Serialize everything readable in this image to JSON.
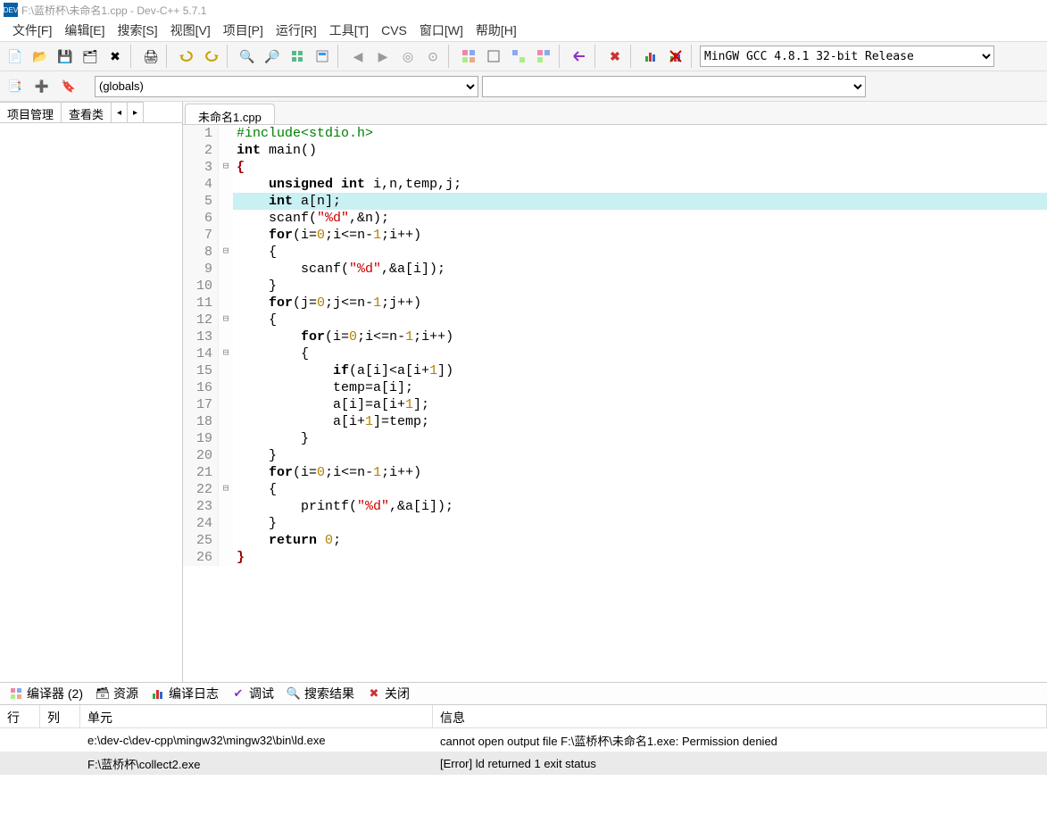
{
  "title": "F:\\蓝桥杯\\未命名1.cpp - Dev-C++ 5.7.1",
  "menu": [
    "文件[F]",
    "编辑[E]",
    "搜索[S]",
    "视图[V]",
    "项目[P]",
    "运行[R]",
    "工具[T]",
    "CVS",
    "窗口[W]",
    "帮助[H]"
  ],
  "compiler_combo": "MinGW GCC 4.8.1 32-bit Release",
  "globals_combo": "(globals)",
  "sidebar_tabs": {
    "project": "项目管理",
    "classview": "查看类"
  },
  "editor_tab": "未命名1.cpp",
  "code": [
    {
      "n": 1,
      "fold": "",
      "html": "<span class='pp'>#include&lt;stdio.h&gt;</span>"
    },
    {
      "n": 2,
      "fold": "",
      "html": "<span class='kw'>int</span> main()"
    },
    {
      "n": 3,
      "fold": "⊟",
      "html": "<span class='brace-red'>{</span>"
    },
    {
      "n": 4,
      "fold": "",
      "html": "    <span class='kw'>unsigned</span> <span class='kw'>int</span> i,n,temp,j;"
    },
    {
      "n": 5,
      "fold": "",
      "hl": true,
      "html": "    <span class='kw'>int</span> a[n];"
    },
    {
      "n": 6,
      "fold": "",
      "html": "    scanf(<span class='str'>\"%d\"</span>,&amp;n);"
    },
    {
      "n": 7,
      "fold": "",
      "html": "    <span class='kw'>for</span>(i=<span class='num'>0</span>;i&lt;=n-<span class='num'>1</span>;i++)"
    },
    {
      "n": 8,
      "fold": "⊟",
      "html": "    {"
    },
    {
      "n": 9,
      "fold": "",
      "html": "        scanf(<span class='str'>\"%d\"</span>,&amp;a[i]);"
    },
    {
      "n": 10,
      "fold": "",
      "html": "    }"
    },
    {
      "n": 11,
      "fold": "",
      "html": "    <span class='kw'>for</span>(j=<span class='num'>0</span>;j&lt;=n-<span class='num'>1</span>;j++)"
    },
    {
      "n": 12,
      "fold": "⊟",
      "html": "    {"
    },
    {
      "n": 13,
      "fold": "",
      "html": "        <span class='kw'>for</span>(i=<span class='num'>0</span>;i&lt;=n-<span class='num'>1</span>;i++)"
    },
    {
      "n": 14,
      "fold": "⊟",
      "html": "        {"
    },
    {
      "n": 15,
      "fold": "",
      "html": "            <span class='kw'>if</span>(a[i]&lt;a[i+<span class='num'>1</span>])"
    },
    {
      "n": 16,
      "fold": "",
      "html": "            temp=a[i];"
    },
    {
      "n": 17,
      "fold": "",
      "html": "            a[i]=a[i+<span class='num'>1</span>];"
    },
    {
      "n": 18,
      "fold": "",
      "html": "            a[i+<span class='num'>1</span>]=temp;"
    },
    {
      "n": 19,
      "fold": "",
      "html": "        }"
    },
    {
      "n": 20,
      "fold": "",
      "html": "    }"
    },
    {
      "n": 21,
      "fold": "",
      "html": "    <span class='kw'>for</span>(i=<span class='num'>0</span>;i&lt;=n-<span class='num'>1</span>;i++)"
    },
    {
      "n": 22,
      "fold": "⊟",
      "html": "    {"
    },
    {
      "n": 23,
      "fold": "",
      "html": "        printf(<span class='str'>\"%d\"</span>,&amp;a[i]);"
    },
    {
      "n": 24,
      "fold": "",
      "html": "    }"
    },
    {
      "n": 25,
      "fold": "",
      "html": "    <span class='kw'>return</span> <span class='num'>0</span>;"
    },
    {
      "n": 26,
      "fold": "",
      "html": "<span class='brace-red'>}</span>"
    }
  ],
  "bottom_tabs": {
    "compiler": "编译器 (2)",
    "resources": "资源",
    "compilelog": "编译日志",
    "debug": "调试",
    "search": "搜索结果",
    "close": "关闭"
  },
  "error_header": {
    "line": "行",
    "col": "列",
    "unit": "单元",
    "msg": "信息"
  },
  "errors": [
    {
      "line": "",
      "col": "",
      "unit": "e:\\dev-c\\dev-cpp\\mingw32\\mingw32\\bin\\ld.exe",
      "msg": "cannot open output file F:\\蓝桥杯\\未命名1.exe: Permission denied",
      "sel": false
    },
    {
      "line": "",
      "col": "",
      "unit": "F:\\蓝桥杯\\collect2.exe",
      "msg": "[Error] ld returned 1 exit status",
      "sel": true
    }
  ]
}
